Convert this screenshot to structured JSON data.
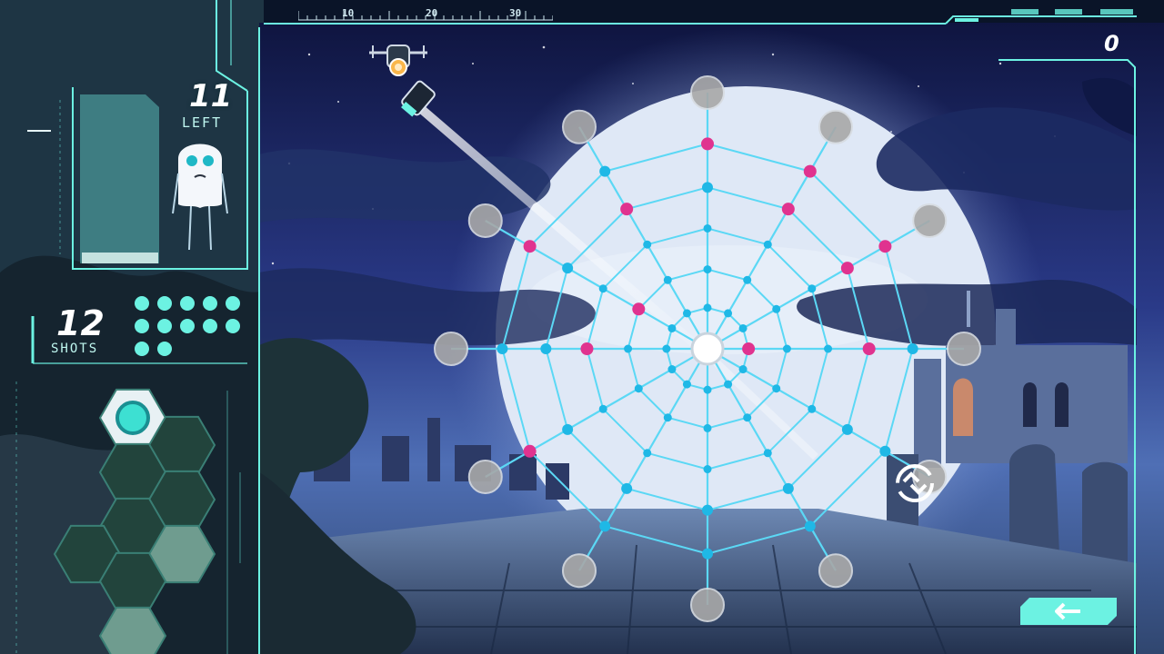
{
  "ruler": {
    "marks": [
      "10",
      "20",
      "30"
    ]
  },
  "score": {
    "value": "0"
  },
  "targets": {
    "count": "11",
    "label": "LEFT"
  },
  "shots": {
    "count": "12",
    "label": "SHOTS",
    "remaining_pips": 12
  },
  "icons": {
    "back": "return-arrow-icon",
    "rotate": "rotate-icon",
    "drone": "drone-cannon-icon",
    "ghost": "ghost-creature-icon"
  },
  "colors": {
    "accent": "#6cf2e2",
    "web_thread": "#5bd8f5",
    "web_node": "#1fb8e6",
    "target_node": "#e0338f",
    "anchor": "#a8a8a8",
    "sky_top": "#141a4a",
    "moon": "#e6edf8"
  }
}
